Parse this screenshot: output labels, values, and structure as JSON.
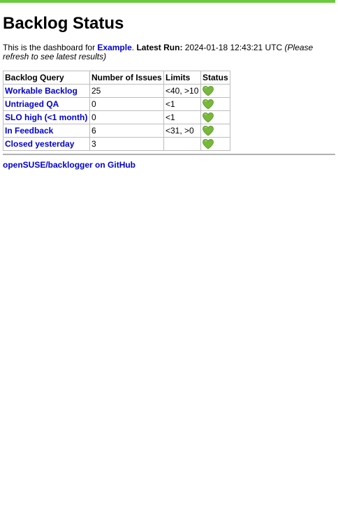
{
  "header": {
    "accent_color": "#6acc3c"
  },
  "page": {
    "title": "Backlog Status",
    "intro_prefix": "This is the dashboard for ",
    "project_link": "Example",
    "intro_sep": ". ",
    "latest_run_label": "Latest Run:",
    "latest_run_value": " 2024-01-18 12:43:21 UTC ",
    "refresh_note": "(Please refresh to see latest results)"
  },
  "table": {
    "headers": [
      "Backlog Query",
      "Number of Issues",
      "Limits",
      "Status"
    ],
    "rows": [
      {
        "query": "Workable Backlog",
        "issues": "25",
        "limits": "<40, >10",
        "status_icon": "green-heart-icon"
      },
      {
        "query": "Untriaged QA",
        "issues": "0",
        "limits": "<1",
        "status_icon": "green-heart-icon"
      },
      {
        "query": "SLO high (<1 month)",
        "issues": "0",
        "limits": "<1",
        "status_icon": "green-heart-icon"
      },
      {
        "query": "In Feedback",
        "issues": "6",
        "limits": "<31, >0",
        "status_icon": "green-heart-icon"
      },
      {
        "query": "Closed yesterday",
        "issues": "3",
        "limits": "",
        "status_icon": "green-heart-icon"
      }
    ]
  },
  "footer": {
    "link": "openSUSE/backlogger on GitHub"
  }
}
